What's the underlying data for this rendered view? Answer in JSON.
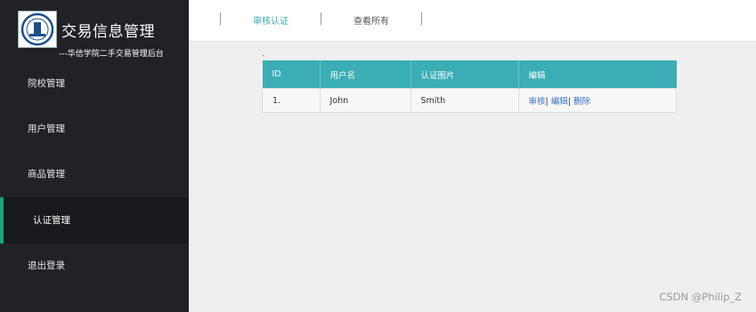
{
  "sidebar": {
    "title": "交易信息管理",
    "subtitle": "---华信学院二手交易管理后台",
    "logo_icon": "university-seal-icon",
    "items": [
      {
        "label": "院校管理"
      },
      {
        "label": "用户管理"
      },
      {
        "label": "商品管理"
      },
      {
        "label": "认证管理",
        "active": true
      },
      {
        "label": "退出登录"
      }
    ]
  },
  "topbar": {
    "tabs": [
      {
        "label": "审核认证",
        "active": true
      },
      {
        "label": "查看所有"
      }
    ]
  },
  "main": {
    "stray_mark": "`",
    "table": {
      "headers": [
        "ID",
        "用户名",
        "认证图片",
        "编辑"
      ],
      "rows": [
        {
          "id": "1.",
          "username": "John",
          "cert_image": "Smith",
          "actions": {
            "review": "审核",
            "sep1": "|",
            "edit": "编辑",
            "sep2": "|",
            "delete": "删除"
          }
        }
      ]
    }
  },
  "watermark": "CSDN @Philip_Z",
  "colors": {
    "sidebar_bg": "#212226",
    "accent_teal": "#3aadb5",
    "active_indicator": "#1aa57c",
    "link_blue": "#3a6fc4"
  }
}
